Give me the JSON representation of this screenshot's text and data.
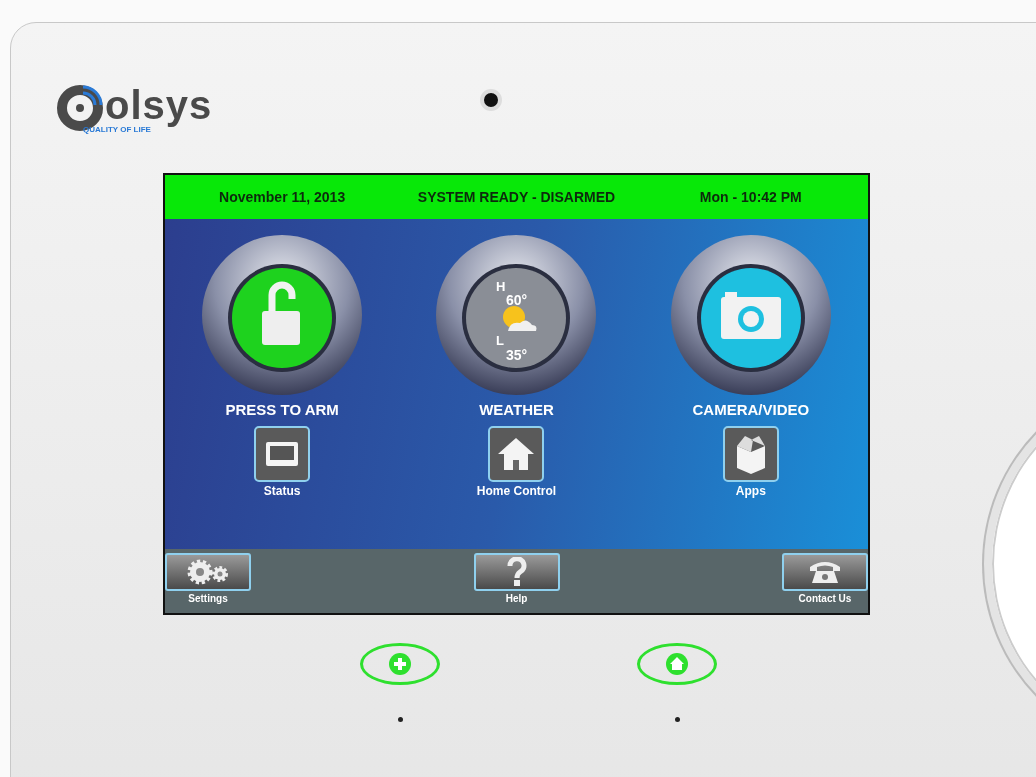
{
  "brand": {
    "name": "olsys",
    "tagline": "QUALITY OF LIFE"
  },
  "status_bar": {
    "date": "November 11, 2013",
    "status": "SYSTEM READY - DISARMED",
    "time": "Mon - 10:42 PM"
  },
  "main_tiles": [
    {
      "kind": "lock",
      "label": "PRESS TO ARM"
    },
    {
      "kind": "weather",
      "label": "WEATHER",
      "high_label": "H",
      "high": "60°",
      "low_label": "L",
      "low": "35°"
    },
    {
      "kind": "camera",
      "label": "CAMERA/VIDEO"
    }
  ],
  "small_tiles": [
    {
      "kind": "status",
      "label": "Status"
    },
    {
      "kind": "home",
      "label": "Home Control"
    },
    {
      "kind": "apps",
      "label": "Apps"
    }
  ],
  "bottom_bar": [
    {
      "kind": "settings",
      "label": "Settings"
    },
    {
      "kind": "help",
      "label": "Help"
    },
    {
      "kind": "phone",
      "label": "Contact Us"
    }
  ],
  "hardware_buttons": [
    {
      "kind": "plus"
    },
    {
      "kind": "home"
    }
  ]
}
